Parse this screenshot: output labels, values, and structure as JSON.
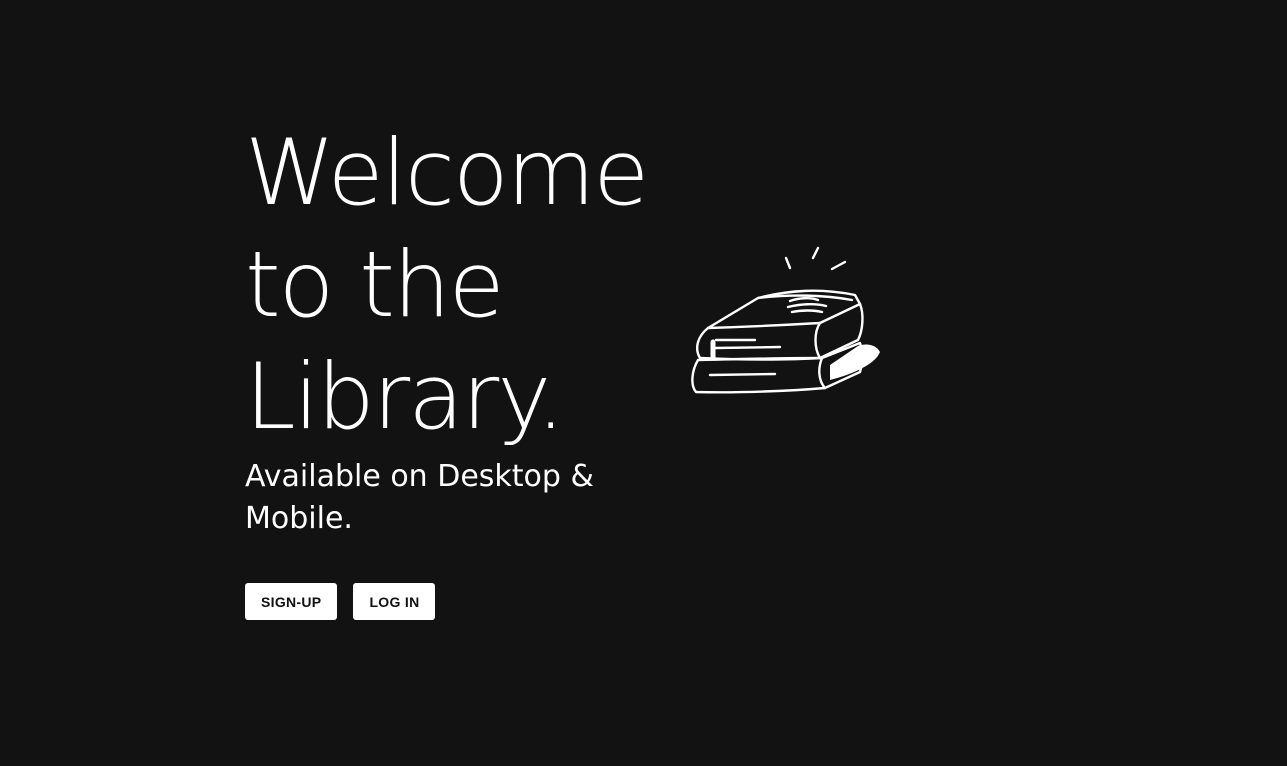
{
  "hero": {
    "title_line_1": "Welcome",
    "title_line_2": "to the",
    "title_line_3": "Library.",
    "subtitle": "Available on Desktop & Mobile."
  },
  "actions": {
    "signup_label": "SIGN-UP",
    "login_label": "LOG IN"
  },
  "illustration": {
    "icon": "books-stack-icon"
  },
  "colors": {
    "background": "#121212",
    "text": "#ffffff",
    "button_bg": "#ffffff",
    "button_text": "#111111"
  }
}
